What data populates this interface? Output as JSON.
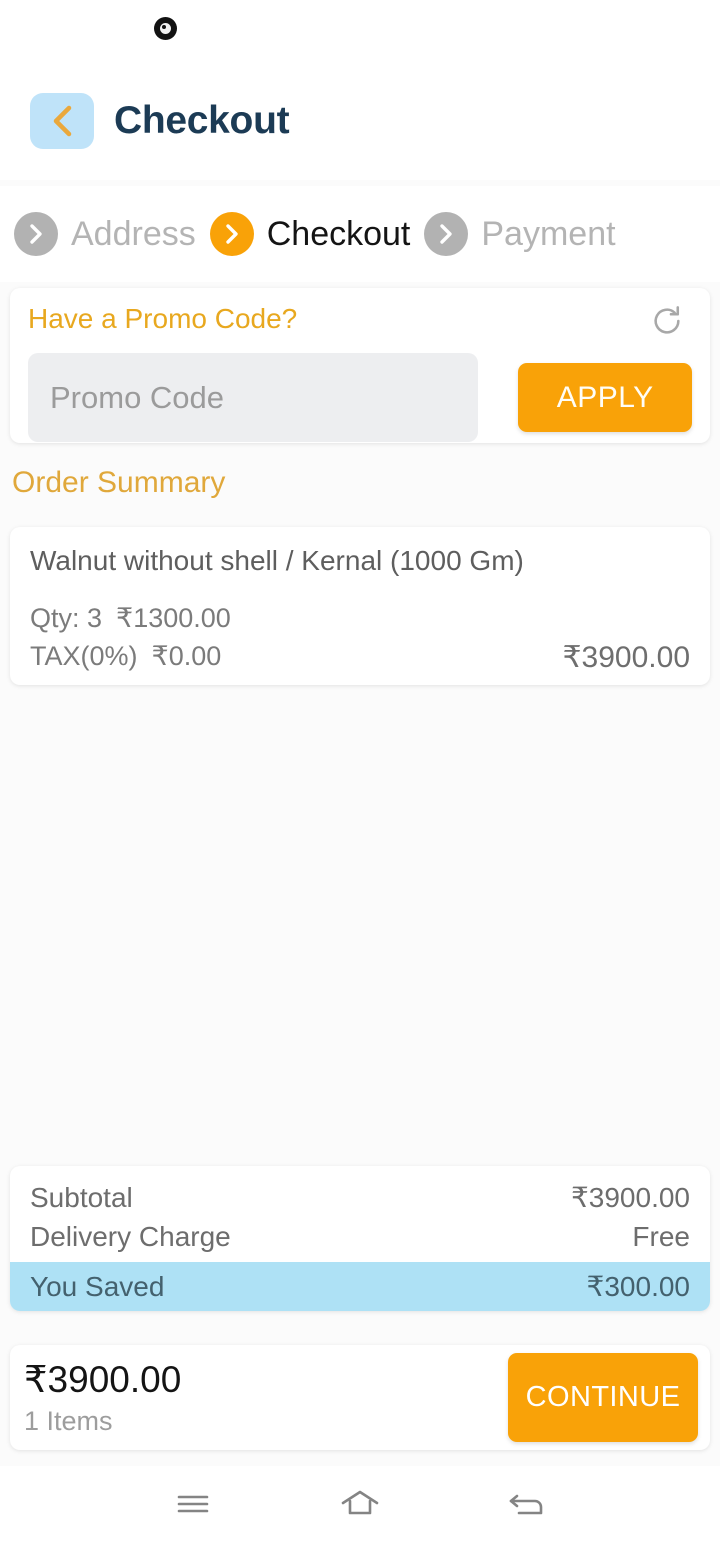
{
  "status_bar": {
    "icon": "app-notification-icon"
  },
  "header": {
    "back_icon": "chevron-left-icon",
    "title": "Checkout",
    "title_color": "#1c3b55",
    "back_bg_color": "#bfe3f9",
    "back_icon_color": "#eaa83c"
  },
  "stepper": {
    "active_color": "#f9a208",
    "inactive_color": "#b2b2b2",
    "steps": [
      {
        "label": "Address",
        "active": false,
        "icon": "chevron-right-icon"
      },
      {
        "label": "Checkout",
        "active": true,
        "icon": "chevron-right-icon"
      },
      {
        "label": "Payment",
        "active": false,
        "icon": "chevron-right-icon"
      }
    ]
  },
  "promo": {
    "title": "Have a Promo Code?",
    "title_color": "#e8a81f",
    "refresh_icon": "refresh-icon",
    "input_value": "",
    "input_placeholder": "Promo Code",
    "apply_label": "APPLY",
    "apply_color": "#f9a208"
  },
  "order_summary": {
    "title": "Order Summary",
    "title_color": "#e0a83b",
    "items": [
      {
        "name": "Walnut without shell / Kernal (1000 Gm)",
        "qty_label": "Qty: 3",
        "unit_price": "₹1300.00",
        "tax_label": "TAX(0%)",
        "tax_amount": "₹0.00",
        "line_total": "₹3900.00"
      }
    ]
  },
  "totals": {
    "rows": [
      {
        "label": "Subtotal",
        "value": "₹3900.00",
        "highlight": false
      },
      {
        "label": "Delivery Charge",
        "value": "Free",
        "highlight": false
      },
      {
        "label": "You Saved",
        "value": "₹300.00",
        "highlight": true
      }
    ],
    "highlight_color": "#aee1f5"
  },
  "footer": {
    "grand_total": "₹3900.00",
    "items_count": "1 Items",
    "continue_label": "CONTINUE",
    "continue_color": "#f9a208"
  },
  "navbar": {
    "buttons": [
      {
        "icon": "menu-icon",
        "name": "recents-button"
      },
      {
        "icon": "home-icon",
        "name": "home-button"
      },
      {
        "icon": "back-arrow-icon",
        "name": "back-button"
      }
    ]
  }
}
